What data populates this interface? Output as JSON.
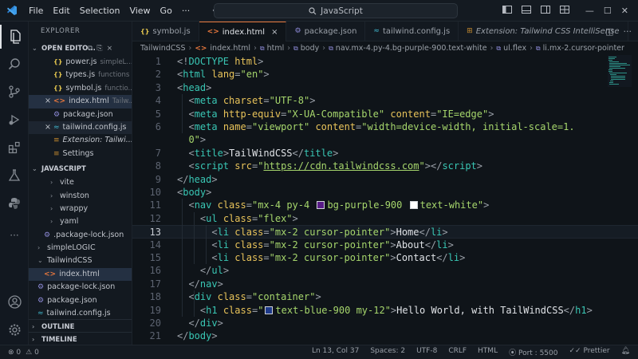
{
  "titlebar": {
    "menu": [
      "File",
      "Edit",
      "Selection",
      "View",
      "Go"
    ],
    "more": "···",
    "search_text": "JavaScript"
  },
  "sidebar": {
    "header": "EXPLORER",
    "open_editors": {
      "title": "OPEN EDITO...",
      "items": [
        {
          "icon": "js",
          "name": "power.js",
          "desc": "simpleL..."
        },
        {
          "icon": "js",
          "name": "types.js",
          "desc": "functions"
        },
        {
          "icon": "js",
          "name": "symbol.js",
          "desc": "functio..."
        },
        {
          "icon": "html",
          "name": "index.html",
          "desc": "Tailw...",
          "close": true,
          "selected": true
        },
        {
          "icon": "json",
          "name": "package.json",
          "desc": ""
        },
        {
          "icon": "tw",
          "name": "tailwind.config.js",
          "desc": "",
          "close": true,
          "active": true
        },
        {
          "icon": "set",
          "name": "Extension: Tailwi...",
          "desc": "",
          "italic": true
        },
        {
          "icon": "set",
          "name": "Settings",
          "desc": ""
        }
      ]
    },
    "project": {
      "title": "JAVASCRIPT",
      "items": [
        {
          "type": "folder",
          "name": "vite",
          "indent": 2
        },
        {
          "type": "folder",
          "name": "winston",
          "indent": 2
        },
        {
          "type": "folder",
          "name": "wrappy",
          "indent": 2
        },
        {
          "type": "folder",
          "name": "yaml",
          "indent": 2
        },
        {
          "type": "json",
          "name": ".package-lock.json",
          "indent": 1
        },
        {
          "type": "folder",
          "name": "simpleLOGIC",
          "indent": 0
        },
        {
          "type": "folder-open",
          "name": "TailwindCSS",
          "indent": 0
        },
        {
          "type": "html",
          "name": "index.html",
          "indent": 1,
          "selected": true
        },
        {
          "type": "json",
          "name": "package-lock.json",
          "indent": 0
        },
        {
          "type": "json",
          "name": "package.json",
          "indent": 0
        },
        {
          "type": "tw",
          "name": "tailwind.config.js",
          "indent": 0
        }
      ]
    },
    "outline": "OUTLINE",
    "timeline": "TIMELINE"
  },
  "tabs": [
    {
      "icon": "js",
      "label": "symbol.js"
    },
    {
      "icon": "html",
      "label": "index.html",
      "active": true,
      "close": "×"
    },
    {
      "icon": "json",
      "label": "package.json"
    },
    {
      "icon": "tw",
      "label": "tailwind.config.js"
    },
    {
      "icon": "ext",
      "label": "Extension: Tailwind CSS IntelliSense",
      "preview": true
    }
  ],
  "breadcrumb": [
    "TailwindCSS",
    "index.html",
    "html",
    "body",
    "nav.mx-4.py-4.bg-purple-900.text-white",
    "ul.flex",
    "li.mx-2.cursor-pointer"
  ],
  "editor": {
    "current_line": 13,
    "lines": [
      {
        "n": "1",
        "html": "<span class=\"t-punc\">&lt;!</span><span class=\"t-tag\">DOCTYPE</span> <span class=\"t-attr\">html</span><span class=\"t-punc\">&gt;</span>"
      },
      {
        "n": "2",
        "html": "<span class=\"t-punc\">&lt;</span><span class=\"t-tag\">html</span> <span class=\"t-attr\">lang</span><span class=\"t-punc\">=</span><span class=\"t-str\">\"en\"</span><span class=\"t-punc\">&gt;</span>"
      },
      {
        "n": "3",
        "html": "<span class=\"t-punc\">&lt;</span><span class=\"t-tag\">head</span><span class=\"t-punc\">&gt;</span>"
      },
      {
        "n": "4",
        "html": "  <span class=\"t-punc\">&lt;</span><span class=\"t-tag\">meta</span> <span class=\"t-attr\">charset</span><span class=\"t-punc\">=</span><span class=\"t-str\">\"UTF-8\"</span><span class=\"t-punc\">&gt;</span>"
      },
      {
        "n": "5",
        "html": "  <span class=\"t-punc\">&lt;</span><span class=\"t-tag\">meta</span> <span class=\"t-attr\">http-equiv</span><span class=\"t-punc\">=</span><span class=\"t-str\">\"X-UA-Compatible\"</span> <span class=\"t-attr\">content</span><span class=\"t-punc\">=</span><span class=\"t-str\">\"IE=edge\"</span><span class=\"t-punc\">&gt;</span>"
      },
      {
        "n": "6",
        "html": "  <span class=\"t-punc\">&lt;</span><span class=\"t-tag\">meta</span> <span class=\"t-attr\">name</span><span class=\"t-punc\">=</span><span class=\"t-str\">\"viewport\"</span> <span class=\"t-attr\">content</span><span class=\"t-punc\">=</span><span class=\"t-str\">\"width=device-width, initial-scale=1.</span>"
      },
      {
        "n": "",
        "html": "  <span class=\"t-str\">0\"</span><span class=\"t-punc\">&gt;</span>"
      },
      {
        "n": "7",
        "html": "  <span class=\"t-punc\">&lt;</span><span class=\"t-tag\">title</span><span class=\"t-punc\">&gt;</span><span class=\"t-txt\">TailWindCSS</span><span class=\"t-punc\">&lt;/</span><span class=\"t-tag\">title</span><span class=\"t-punc\">&gt;</span>"
      },
      {
        "n": "8",
        "html": "  <span class=\"t-punc\">&lt;</span><span class=\"t-tag\">script</span> <span class=\"t-attr\">src</span><span class=\"t-punc\">=</span><span class=\"t-str\">\"</span><span class=\"t-link\">https://cdn.tailwindcss.com</span><span class=\"t-str\">\"</span><span class=\"t-punc\">&gt;&lt;/</span><span class=\"t-tag\">script</span><span class=\"t-punc\">&gt;</span>"
      },
      {
        "n": "9",
        "html": "<span class=\"t-punc\">&lt;/</span><span class=\"t-tag\">head</span><span class=\"t-punc\">&gt;</span>"
      },
      {
        "n": "10",
        "html": "<span class=\"t-punc\">&lt;</span><span class=\"t-tag\">body</span><span class=\"t-punc\">&gt;</span>"
      },
      {
        "n": "11",
        "html": "  <span class=\"t-punc\">&lt;</span><span class=\"t-tag\">nav</span> <span class=\"t-attr\">class</span><span class=\"t-punc\">=</span><span class=\"t-str\">\"mx-4 py-4 <span class=\"swatch\" style=\"background:#581c87\"></span>bg-purple-900 <span class=\"swatch\" style=\"background:#ffffff\"></span>text-white\"</span><span class=\"t-punc\">&gt;</span>"
      },
      {
        "n": "12",
        "html": "    <span class=\"t-punc\">&lt;</span><span class=\"t-tag\">ul</span> <span class=\"t-attr\">class</span><span class=\"t-punc\">=</span><span class=\"t-str\">\"flex\"</span><span class=\"t-punc\">&gt;</span>"
      },
      {
        "n": "13",
        "html": "      <span class=\"t-punc\">&lt;</span><span class=\"t-tag\">li</span> <span class=\"t-attr\">class</span><span class=\"t-punc\">=</span><span class=\"t-str\">\"mx-2 cursor-pointer\"</span><span class=\"t-punc\">&gt;</span><span class=\"t-txt\">Home</span><span class=\"t-punc\">&lt;/</span><span class=\"t-tag\">li</span><span class=\"t-punc\">&gt;</span>"
      },
      {
        "n": "14",
        "html": "      <span class=\"t-punc\">&lt;</span><span class=\"t-tag\">li</span> <span class=\"t-attr\">class</span><span class=\"t-punc\">=</span><span class=\"t-str\">\"mx-2 cursor-pointer\"</span><span class=\"t-punc\">&gt;</span><span class=\"t-txt\">About</span><span class=\"t-punc\">&lt;/</span><span class=\"t-tag\">li</span><span class=\"t-punc\">&gt;</span>"
      },
      {
        "n": "15",
        "html": "      <span class=\"t-punc\">&lt;</span><span class=\"t-tag\">li</span> <span class=\"t-attr\">class</span><span class=\"t-punc\">=</span><span class=\"t-str\">\"mx-2 cursor-pointer\"</span><span class=\"t-punc\">&gt;</span><span class=\"t-txt\">Contact</span><span class=\"t-punc\">&lt;/</span><span class=\"t-tag\">li</span><span class=\"t-punc\">&gt;</span>"
      },
      {
        "n": "16",
        "html": "    <span class=\"t-punc\">&lt;/</span><span class=\"t-tag\">ul</span><span class=\"t-punc\">&gt;</span>"
      },
      {
        "n": "17",
        "html": "  <span class=\"t-punc\">&lt;/</span><span class=\"t-tag\">nav</span><span class=\"t-punc\">&gt;</span>"
      },
      {
        "n": "18",
        "html": "  <span class=\"t-punc\">&lt;</span><span class=\"t-tag\">div</span> <span class=\"t-attr\">class</span><span class=\"t-punc\">=</span><span class=\"t-str\">\"container\"</span><span class=\"t-punc\">&gt;</span>"
      },
      {
        "n": "19",
        "html": "    <span class=\"t-punc\">&lt;</span><span class=\"t-tag\">h1</span> <span class=\"t-attr\">class</span><span class=\"t-punc\">=</span><span class=\"t-str\">\"<span class=\"swatch\" style=\"background:#1e3a8a\"></span>text-blue-900 my-12\"</span><span class=\"t-punc\">&gt;</span><span class=\"t-txt\">Hello World, with TailWindCSS</span><span class=\"t-punc\">&lt;/</span><span class=\"t-tag\">h1</span><span class=\"t-punc\">&gt;</span>"
      },
      {
        "n": "20",
        "html": "  <span class=\"t-punc\">&lt;/</span><span class=\"t-tag\">div</span><span class=\"t-punc\">&gt;</span>"
      },
      {
        "n": "21",
        "html": "<span class=\"t-punc\">&lt;/</span><span class=\"t-tag\">body</span><span class=\"t-punc\">&gt;</span>"
      }
    ]
  },
  "statusbar": {
    "errors": "0",
    "warnings": "0",
    "position": "Ln 13, Col 37",
    "spaces": "Spaces: 2",
    "encoding": "UTF-8",
    "eol": "CRLF",
    "language": "HTML",
    "port": "Port : 5500",
    "prettier": "Prettier"
  },
  "colors": {
    "accent": "#e7773d",
    "tag": "#39c6b4",
    "attr": "#e8c35a",
    "string": "#a6d66c",
    "swatch_purple": "#581c87",
    "swatch_white": "#ffffff",
    "swatch_blue": "#1e3a8a"
  }
}
